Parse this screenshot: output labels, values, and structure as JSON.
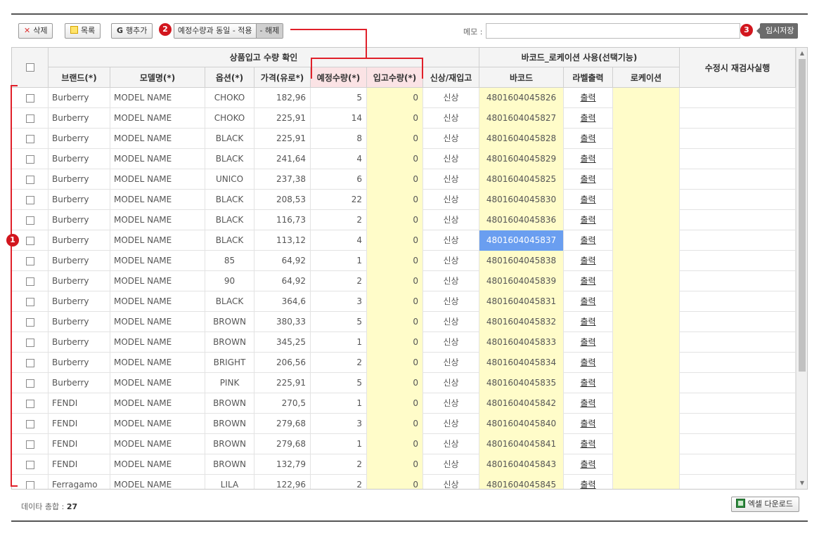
{
  "toolbar": {
    "delete_label": "삭제",
    "list_label": "목록",
    "add_row_label": "행추가",
    "apply_label": "예정수량과 동일 - 적용",
    "release_label": "- 해제",
    "memo_label": "메모 :",
    "memo_value": "",
    "save_label": "임시저장"
  },
  "annotations": {
    "one": "1",
    "two": "2",
    "three": "3"
  },
  "header": {
    "group_confirm": "상품입고 수량 확인",
    "group_barcode": "바코드_로케이션 사용(선택기능)",
    "recheck": "수정시 재검사실행",
    "brand": "브랜드(*)",
    "model": "모델명(*)",
    "option": "옵션(*)",
    "price": "가격(유로*)",
    "planned_qty": "예정수량(*)",
    "received_qty": "입고수량(*)",
    "new_re": "신상/재입고",
    "barcode": "바코드",
    "label_print": "라벨출력",
    "location": "로케이션"
  },
  "rows": [
    {
      "brand": "Burberry",
      "model": "MODEL NAME",
      "option": "CHOKO",
      "price": "182,96",
      "planned": "5",
      "received": "0",
      "type": "신상",
      "barcode": "4801604045826",
      "print": "출력"
    },
    {
      "brand": "Burberry",
      "model": "MODEL NAME",
      "option": "CHOKO",
      "price": "225,91",
      "planned": "14",
      "received": "0",
      "type": "신상",
      "barcode": "4801604045827",
      "print": "출력"
    },
    {
      "brand": "Burberry",
      "model": "MODEL NAME",
      "option": "BLACK",
      "price": "225,91",
      "planned": "8",
      "received": "0",
      "type": "신상",
      "barcode": "4801604045828",
      "print": "출력"
    },
    {
      "brand": "Burberry",
      "model": "MODEL NAME",
      "option": "BLACK",
      "price": "241,64",
      "planned": "4",
      "received": "0",
      "type": "신상",
      "barcode": "4801604045829",
      "print": "출력"
    },
    {
      "brand": "Burberry",
      "model": "MODEL NAME",
      "option": "UNICO",
      "price": "237,38",
      "planned": "6",
      "received": "0",
      "type": "신상",
      "barcode": "4801604045825",
      "print": "출력"
    },
    {
      "brand": "Burberry",
      "model": "MODEL NAME",
      "option": "BLACK",
      "price": "208,53",
      "planned": "22",
      "received": "0",
      "type": "신상",
      "barcode": "4801604045830",
      "print": "출력"
    },
    {
      "brand": "Burberry",
      "model": "MODEL NAME",
      "option": "BLACK",
      "price": "116,73",
      "planned": "2",
      "received": "0",
      "type": "신상",
      "barcode": "4801604045836",
      "print": "출력"
    },
    {
      "brand": "Burberry",
      "model": "MODEL NAME",
      "option": "BLACK",
      "price": "113,12",
      "planned": "4",
      "received": "0",
      "type": "신상",
      "barcode": "4801604045837",
      "print": "출력",
      "selected": true
    },
    {
      "brand": "Burberry",
      "model": "MODEL NAME",
      "option": "85",
      "price": "64,92",
      "planned": "1",
      "received": "0",
      "type": "신상",
      "barcode": "4801604045838",
      "print": "출력"
    },
    {
      "brand": "Burberry",
      "model": "MODEL NAME",
      "option": "90",
      "price": "64,92",
      "planned": "2",
      "received": "0",
      "type": "신상",
      "barcode": "4801604045839",
      "print": "출력"
    },
    {
      "brand": "Burberry",
      "model": "MODEL NAME",
      "option": "BLACK",
      "price": "364,6",
      "planned": "3",
      "received": "0",
      "type": "신상",
      "barcode": "4801604045831",
      "print": "출력"
    },
    {
      "brand": "Burberry",
      "model": "MODEL NAME",
      "option": "BROWN",
      "price": "380,33",
      "planned": "5",
      "received": "0",
      "type": "신상",
      "barcode": "4801604045832",
      "print": "출력"
    },
    {
      "brand": "Burberry",
      "model": "MODEL NAME",
      "option": "BROWN",
      "price": "345,25",
      "planned": "1",
      "received": "0",
      "type": "신상",
      "barcode": "4801604045833",
      "print": "출력"
    },
    {
      "brand": "Burberry",
      "model": "MODEL NAME",
      "option": "BRIGHT",
      "price": "206,56",
      "planned": "2",
      "received": "0",
      "type": "신상",
      "barcode": "4801604045834",
      "print": "출력"
    },
    {
      "brand": "Burberry",
      "model": "MODEL NAME",
      "option": "PINK",
      "price": "225,91",
      "planned": "5",
      "received": "0",
      "type": "신상",
      "barcode": "4801604045835",
      "print": "출력"
    },
    {
      "brand": "FENDI",
      "model": "MODEL NAME",
      "option": "BROWN",
      "price": "270,5",
      "planned": "1",
      "received": "0",
      "type": "신상",
      "barcode": "4801604045842",
      "print": "출력"
    },
    {
      "brand": "FENDI",
      "model": "MODEL NAME",
      "option": "BROWN",
      "price": "279,68",
      "planned": "3",
      "received": "0",
      "type": "신상",
      "barcode": "4801604045840",
      "print": "출력"
    },
    {
      "brand": "FENDI",
      "model": "MODEL NAME",
      "option": "BROWN",
      "price": "279,68",
      "planned": "1",
      "received": "0",
      "type": "신상",
      "barcode": "4801604045841",
      "print": "출력"
    },
    {
      "brand": "FENDI",
      "model": "MODEL NAME",
      "option": "BROWN",
      "price": "132,79",
      "planned": "2",
      "received": "0",
      "type": "신상",
      "barcode": "4801604045843",
      "print": "출력"
    },
    {
      "brand": "Ferragamo",
      "model": "MODEL NAME",
      "option": "LILA",
      "price": "122,96",
      "planned": "2",
      "received": "0",
      "type": "신상",
      "barcode": "4801604045845",
      "print": "출력"
    }
  ],
  "footer": {
    "total_label": "데이타 총합 :",
    "total_value": "27",
    "excel_label": "엑셀 다운로드"
  },
  "colors": {
    "annotation_red": "#e0202a",
    "selected_cell": "#6a9ef0",
    "input_yellow": "#fffcc9",
    "header_pink": "#fbe3e5"
  }
}
